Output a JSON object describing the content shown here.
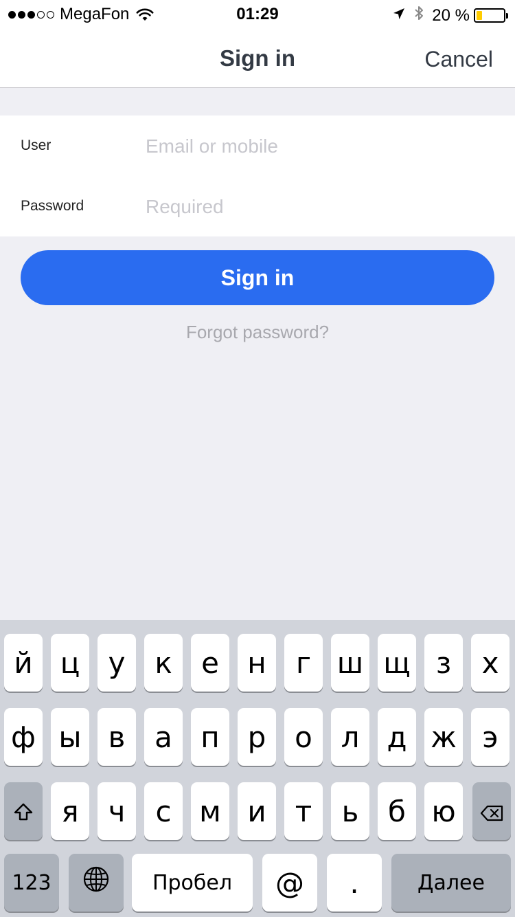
{
  "status": {
    "carrier": "MegaFon",
    "signal_bars_filled": 3,
    "signal_bars_total": 5,
    "time": "01:29",
    "battery_percent": "20 %",
    "battery_level": 0.2,
    "battery_color": "#ffcc00",
    "icons": [
      "wifi-icon",
      "location-arrow-icon",
      "bluetooth-icon",
      "battery-icon"
    ]
  },
  "nav": {
    "title": "Sign in",
    "cancel_label": "Cancel"
  },
  "form": {
    "user_label": "User",
    "user_placeholder": "Email or mobile",
    "user_value": "",
    "password_label": "Password",
    "password_placeholder": "Required",
    "password_value": ""
  },
  "actions": {
    "signin_label": "Sign in",
    "signin_color": "#2a6cf0",
    "forgot_label": "Forgot password?"
  },
  "keyboard": {
    "row1": [
      "й",
      "ц",
      "у",
      "к",
      "е",
      "н",
      "г",
      "ш",
      "щ",
      "з",
      "х"
    ],
    "row2": [
      "ф",
      "ы",
      "в",
      "а",
      "п",
      "р",
      "о",
      "л",
      "д",
      "ж",
      "э"
    ],
    "row3": [
      "я",
      "ч",
      "с",
      "м",
      "и",
      "т",
      "ь",
      "б",
      "ю"
    ],
    "numbers_label": "123",
    "space_label": "Пробел",
    "at_label": "@",
    "dot_label": ".",
    "return_label": "Далее"
  }
}
